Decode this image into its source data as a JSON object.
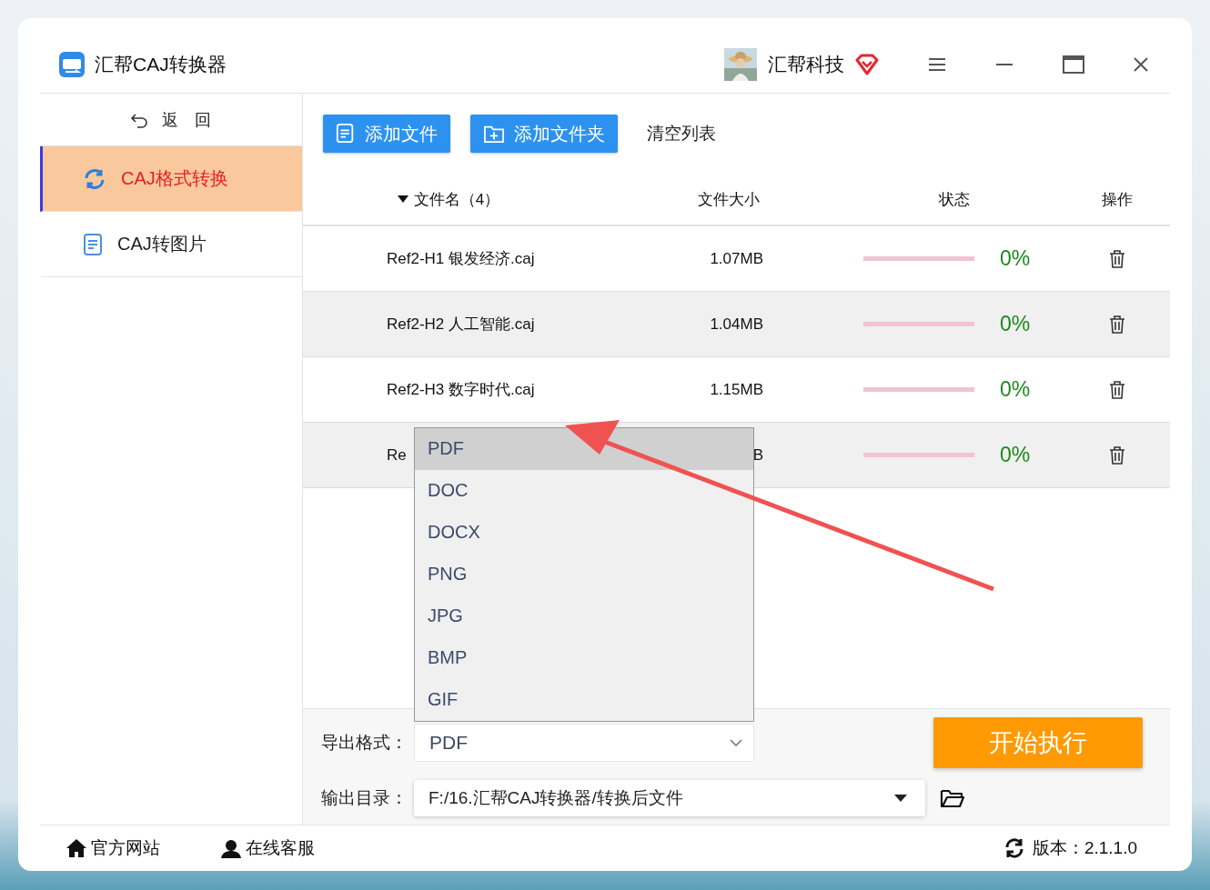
{
  "window": {
    "title": "汇帮CAJ转换器",
    "user": "汇帮科技"
  },
  "sidebar": {
    "back": "返　回",
    "items": [
      {
        "label": "CAJ格式转换",
        "selected": true
      },
      {
        "label": "CAJ转图片",
        "selected": false
      }
    ]
  },
  "toolbar": {
    "add_file": "添加文件",
    "add_folder": "添加文件夹",
    "clear": "清空列表"
  },
  "table": {
    "columns": [
      "文件名（4）",
      "文件大小",
      "状态",
      "操作"
    ],
    "rows": [
      {
        "name": "Ref2-H1 银发经济.caj",
        "size": "1.07MB",
        "level": 0,
        "percent": "0%"
      },
      {
        "name": "Ref2-H2 人工智能.caj",
        "size": "1.04MB",
        "level": 0,
        "percent": "0%"
      },
      {
        "name": "Ref2-H3 数字时代.caj",
        "size": "1.15MB",
        "level": 0,
        "percent": "0%"
      },
      {
        "name": "Re",
        "size": "B",
        "level": 0,
        "percent": "0%"
      }
    ]
  },
  "format": {
    "label": "导出格式：",
    "value": "PDF",
    "expanded": true,
    "options": [
      {
        "label": "PDF",
        "selected": true
      },
      {
        "label": "DOC",
        "selected": false
      },
      {
        "label": "DOCX",
        "selected": false
      },
      {
        "label": "PNG",
        "selected": false
      },
      {
        "label": "JPG",
        "selected": false
      },
      {
        "label": "BMP",
        "selected": false
      },
      {
        "label": "GIF",
        "selected": false
      }
    ]
  },
  "output": {
    "label": "输出目录：",
    "value": "F:/16.汇帮CAJ转换器/转换后文件"
  },
  "start_button": "开始执行",
  "footer": {
    "links": [
      "官方网站",
      "在线客服"
    ],
    "version": "版本：2.1.1.0"
  }
}
